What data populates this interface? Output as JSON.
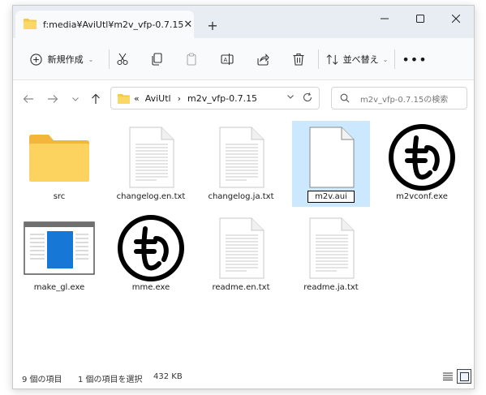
{
  "tab": {
    "title": "f:media¥AviUtl¥m2v_vfp-0.7.15"
  },
  "toolbar": {
    "new_label": "新規作成",
    "sort_label": "並べ替え"
  },
  "address": {
    "overflow": "«",
    "crumbs": [
      "AviUtl",
      "m2v_vfp-0.7.15"
    ],
    "separator": "›"
  },
  "search": {
    "placeholder": "m2v_vfp-0.7.15の検索"
  },
  "files": [
    {
      "name": "src",
      "icon": "folder-icon"
    },
    {
      "name": "changelog.en.txt",
      "icon": "text-file-icon"
    },
    {
      "name": "changelog.ja.txt",
      "icon": "text-file-icon"
    },
    {
      "name": "m2v.aui",
      "icon": "blank-file-icon",
      "selected": true
    },
    {
      "name": "m2vconf.exe",
      "icon": "mo-logo-icon"
    },
    {
      "name": "make_gl.exe",
      "icon": "app-window-icon"
    },
    {
      "name": "mme.exe",
      "icon": "mo-logo-icon"
    },
    {
      "name": "readme.en.txt",
      "icon": "text-file-icon"
    },
    {
      "name": "readme.ja.txt",
      "icon": "text-file-icon"
    }
  ],
  "status": {
    "item_count": "9 個の項目",
    "selected_count": "1 個の項目を選択",
    "selected_size": "432 KB"
  },
  "colors": {
    "selection": "#cce8ff",
    "folder": "#f7c948",
    "accent": "#0078d4"
  }
}
